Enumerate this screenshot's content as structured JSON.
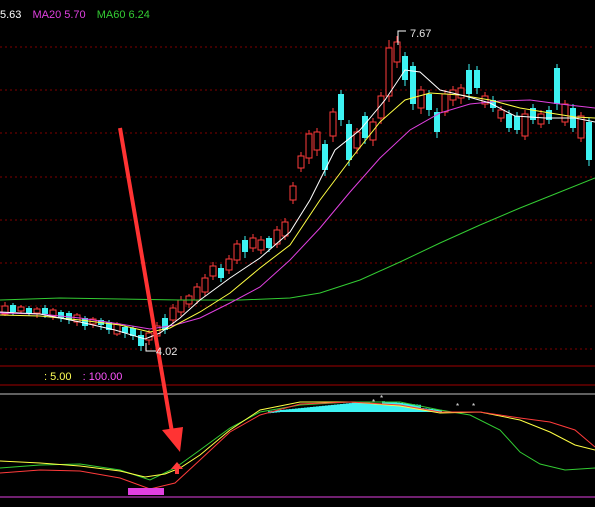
{
  "header": {
    "ma_items": [
      {
        "value": "5.63",
        "color": "#ffffff"
      },
      {
        "name": "MA20",
        "value": "5.70",
        "color": "#e040e0"
      },
      {
        "name": "MA60",
        "value": "6.24",
        "color": "#33cc33"
      }
    ]
  },
  "price_annotations": {
    "high": "7.67",
    "low": "4.02"
  },
  "indicator": {
    "param1": "5.00",
    "param2": "100.00",
    "param1_color": "#ffff55",
    "param2_color": "#ff55ff"
  },
  "colors": {
    "up": "#ff3b3b",
    "down": "#3df2f2",
    "ma5": "#ffffff",
    "ma10": "#ffff44",
    "ma20": "#e040e0",
    "ma60": "#33cc33",
    "grid": "#800000",
    "arrow": "#ff3333"
  },
  "icons": {
    "signal": "red-up-arrow-icon",
    "annotation": "long-red-arrow-icon"
  }
}
